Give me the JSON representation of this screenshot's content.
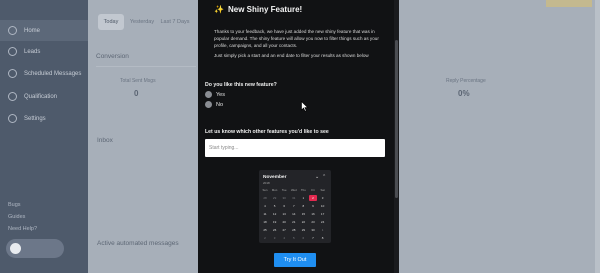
{
  "sidebar": {
    "items": [
      {
        "label": "Home",
        "icon": "home-icon"
      },
      {
        "label": "Leads",
        "icon": "users-icon"
      },
      {
        "label": "Scheduled Messages",
        "icon": "clock-icon"
      },
      {
        "label": "Qualification",
        "icon": "filter-icon"
      },
      {
        "label": "Settings",
        "icon": "gear-icon"
      }
    ],
    "footer": [
      "Bugs",
      "Guides",
      "Need Help?"
    ]
  },
  "main": {
    "tabs": [
      "Today",
      "Yesterday",
      "Last 7 Days"
    ],
    "conversion_title": "Conversion",
    "stats": [
      {
        "label": "Total Sent Msgs",
        "value": "0"
      },
      {
        "label": "Reply Percentage",
        "value": "0%"
      }
    ],
    "inbox_title": "Inbox",
    "automated_title": "Active automated messages"
  },
  "modal": {
    "title": "New Shiny Feature!",
    "paragraph1": "Thanks to your feedback, we have just added the new shiny feature that was in popular demand. The shiny feature will allow you now to filter things such as your profile, campaigns, and all your contacts.",
    "paragraph2": "Just simply pick a start and an end date to filter your results as shown below",
    "question1": "Do you like this new feature?",
    "options": [
      "Yes",
      "No"
    ],
    "question2": "Let us know which other features you'd like to see",
    "input_placeholder": "Start typing...",
    "calendar": {
      "month": "November",
      "year": "2018",
      "weekdays": [
        "Sun",
        "Mon",
        "Tue",
        "Wed",
        "Thu",
        "Fri",
        "Sat"
      ],
      "weeks": [
        [
          "28",
          "29",
          "30",
          "31",
          "1",
          "2",
          "3"
        ],
        [
          "4",
          "5",
          "6",
          "7",
          "8",
          "9",
          "10"
        ],
        [
          "11",
          "12",
          "13",
          "14",
          "15",
          "16",
          "17"
        ],
        [
          "18",
          "19",
          "20",
          "21",
          "22",
          "23",
          "24"
        ],
        [
          "25",
          "26",
          "27",
          "28",
          "29",
          "30",
          "1"
        ],
        [
          "2",
          "3",
          "4",
          "5",
          "6",
          "7",
          "8"
        ]
      ],
      "selected": "2"
    },
    "button_label": "Try It Out"
  },
  "colors": {
    "accent": "#1f8ef1",
    "selected_day": "#e2294f",
    "modal_bg": "#111214"
  }
}
